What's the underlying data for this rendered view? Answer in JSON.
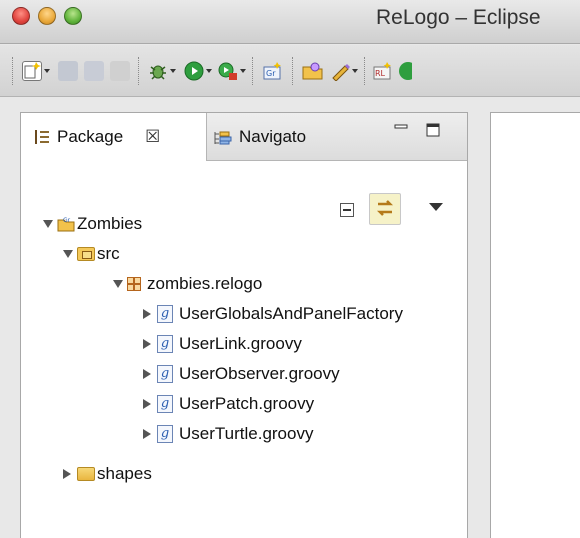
{
  "window": {
    "title": "ReLogo – Eclipse"
  },
  "toolbar": {
    "icons": [
      "new-wizard-icon",
      "save-icon",
      "save-all-icon",
      "print-icon",
      "debug-icon",
      "run-icon",
      "run-external-icon",
      "new-groovy-icon",
      "open-folder-icon",
      "edit-icon",
      "relogo-icon"
    ]
  },
  "panel": {
    "tabs": [
      {
        "label": "Package",
        "close": "☒",
        "active": true
      },
      {
        "label": "Navigato",
        "active": false
      }
    ],
    "controls": {
      "minimize": "▭",
      "maximize": "☐"
    }
  },
  "tree": {
    "project": "Zombies",
    "src_folder": "src",
    "package": "zombies.relogo",
    "files": [
      "UserGlobalsAndPanelFactory",
      "UserLink.groovy",
      "UserObserver.groovy",
      "UserPatch.groovy",
      "UserTurtle.groovy"
    ],
    "shapes_folder": "shapes",
    "groovy_glyph": "g"
  },
  "colors": {
    "accent": "#e0443e",
    "panel_bg": "#ffffff",
    "chrome_bg": "#e8e8e8"
  }
}
